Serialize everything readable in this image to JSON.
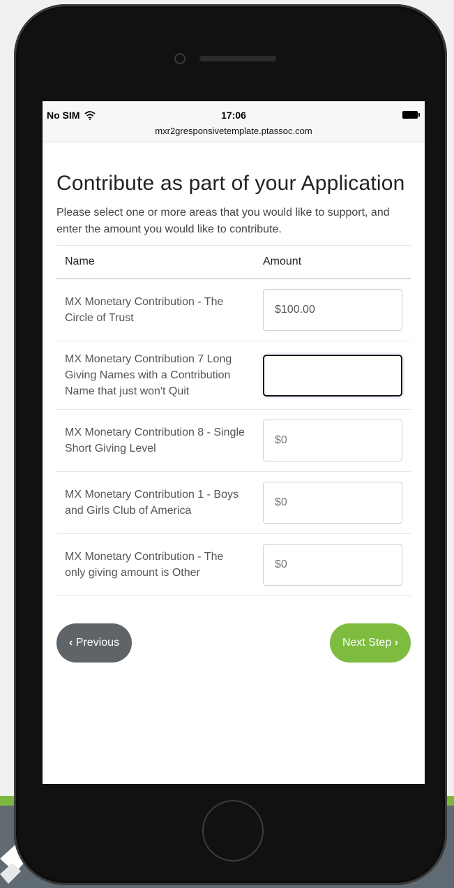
{
  "status_bar": {
    "carrier": "No SIM",
    "time": "17:06",
    "url": "mxr2gresponsivetemplate.ptassoc.com"
  },
  "form": {
    "title": "Contribute as part of your Application",
    "intro": "Please select one or more areas that you would like to support, and enter the amount you would like to contribute.",
    "columns": {
      "name": "Name",
      "amount": "Amount"
    },
    "rows": [
      {
        "name": "MX Monetary Contribution - The Circle of Trust",
        "amount": "$100.00",
        "placeholder": ""
      },
      {
        "name": "MX Monetary Contribution 7 Long Giving Names with a Contribution Name that just won't Quit",
        "amount": "",
        "placeholder": ""
      },
      {
        "name": "MX Monetary Contribution 8 - Single Short Giving Level",
        "amount": "",
        "placeholder": "$0"
      },
      {
        "name": "MX Monetary Contribution 1 - Boys and Girls Club of America",
        "amount": "",
        "placeholder": "$0"
      },
      {
        "name": "MX Monetary Contribution - The only giving amount is Other",
        "amount": "",
        "placeholder": "$0"
      }
    ]
  },
  "nav": {
    "previous_label": "Previous",
    "next_label": "Next Step",
    "previous_icon": "chevron-left-icon",
    "next_icon": "chevron-right-icon"
  },
  "colors": {
    "next_button": "#7dbc3f",
    "previous_button": "#5f6469",
    "focus_border": "#6ea8e8"
  }
}
